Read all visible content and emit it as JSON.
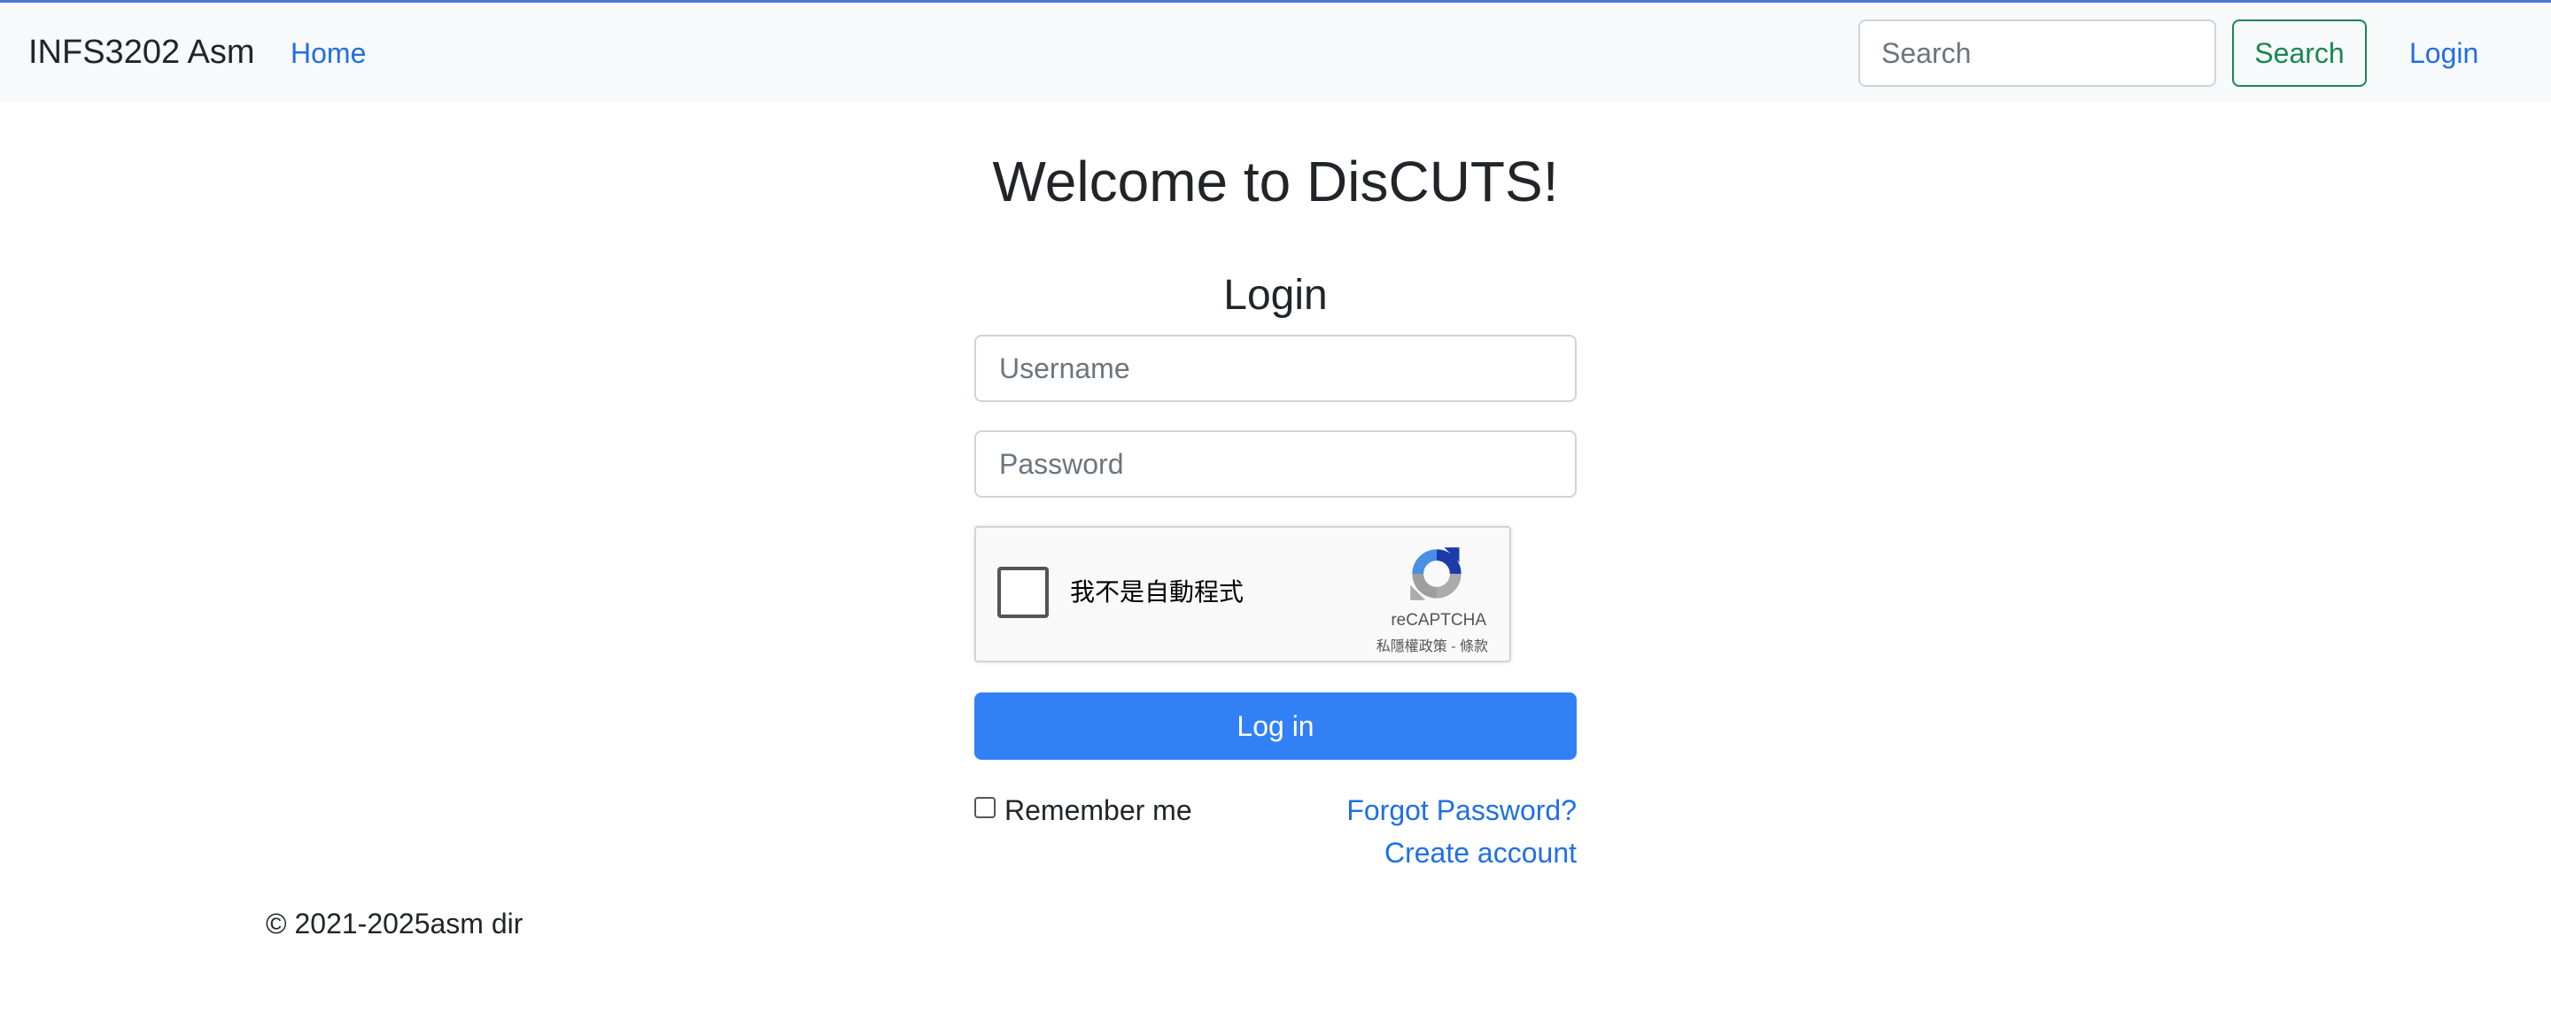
{
  "navbar": {
    "brand": "INFS3202 Asm",
    "home_label": "Home",
    "search_placeholder": "Search",
    "search_button": "Search",
    "login_label": "Login"
  },
  "main": {
    "welcome": "Welcome to DisCUTS!",
    "login_title": "Login",
    "username_placeholder": "Username",
    "password_placeholder": "Password",
    "captcha": {
      "label": "我不是自動程式",
      "brand": "reCAPTCHA",
      "terms": "私隱權政策 - 條款",
      "logo_icon": "recaptcha-icon"
    },
    "login_button": "Log in",
    "remember_me": "Remember me",
    "forgot_password": "Forgot Password?",
    "create_account": "Create account"
  },
  "footer": {
    "copyright": "© 2021-2025asm dir"
  },
  "colors": {
    "link": "#1f6fe5",
    "primary_button": "#3280f6",
    "success_outline": "#198754",
    "navbar_bg": "#f8f9fa"
  }
}
